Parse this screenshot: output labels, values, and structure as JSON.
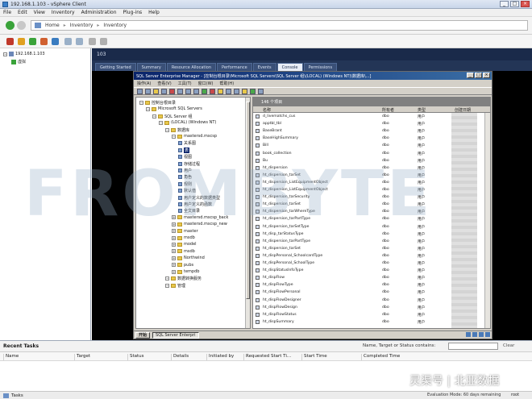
{
  "window": {
    "title": "192.168.1.103 - vSphere Client",
    "controls": [
      "_",
      "□",
      "×"
    ]
  },
  "menubar": [
    "File",
    "Edit",
    "View",
    "Inventory",
    "Administration",
    "Plug-ins",
    "Help"
  ],
  "navbar": {
    "path": [
      "Home",
      "Inventory",
      "Inventory"
    ]
  },
  "left_tree": [
    {
      "label": "192.168.1.103",
      "icon": "host-icon"
    },
    {
      "label": "虚拟",
      "icon": "vm-icon"
    }
  ],
  "right_pane": {
    "host_label": "103",
    "tabs": [
      "Getting Started",
      "Summary",
      "Resource Allocation",
      "Performance",
      "Events",
      "Console",
      "Permissions"
    ],
    "active_tab": "Console"
  },
  "sql_window": {
    "title": "SQL Server Enterprise Manager - [控制台根目录\\Microsoft SQL Servers\\SQL Server 组\\(LOCAL) (Windows NT)\\数据库\\...]",
    "menu": [
      "操作(A)",
      "查看(V)",
      "工具(T)",
      "窗口(W)",
      "帮助(H)"
    ],
    "tree": [
      {
        "label": "控制台根目录",
        "depth": 0,
        "kind": "folder"
      },
      {
        "label": "Microsoft SQL Servers",
        "depth": 1,
        "kind": "folder"
      },
      {
        "label": "SQL Server 组",
        "depth": 2,
        "kind": "folder"
      },
      {
        "label": "(LOCAL) (Windows NT)",
        "depth": 3,
        "kind": "server"
      },
      {
        "label": "数据库",
        "depth": 4,
        "kind": "folder"
      },
      {
        "label": "mastersd.mscsp",
        "depth": 5,
        "kind": "db"
      },
      {
        "label": "关系图",
        "depth": 6,
        "kind": "item"
      },
      {
        "label": "表",
        "depth": 6,
        "kind": "item",
        "selected": true
      },
      {
        "label": "视图",
        "depth": 6,
        "kind": "item"
      },
      {
        "label": "存储过程",
        "depth": 6,
        "kind": "item"
      },
      {
        "label": "用户",
        "depth": 6,
        "kind": "item"
      },
      {
        "label": "角色",
        "depth": 6,
        "kind": "item"
      },
      {
        "label": "规则",
        "depth": 6,
        "kind": "item"
      },
      {
        "label": "默认值",
        "depth": 6,
        "kind": "item"
      },
      {
        "label": "用户定义的数据类型",
        "depth": 6,
        "kind": "item"
      },
      {
        "label": "用户定义的函数",
        "depth": 6,
        "kind": "item"
      },
      {
        "label": "全文目录",
        "depth": 6,
        "kind": "item"
      },
      {
        "label": "mastersd.mscsp_back",
        "depth": 5,
        "kind": "db"
      },
      {
        "label": "mastersd.mscsp_new",
        "depth": 5,
        "kind": "db"
      },
      {
        "label": "master",
        "depth": 5,
        "kind": "db"
      },
      {
        "label": "msdb",
        "depth": 5,
        "kind": "db"
      },
      {
        "label": "model",
        "depth": 5,
        "kind": "db"
      },
      {
        "label": "msdb",
        "depth": 5,
        "kind": "db"
      },
      {
        "label": "Northwind",
        "depth": 5,
        "kind": "db"
      },
      {
        "label": "pubs",
        "depth": 5,
        "kind": "db"
      },
      {
        "label": "tempdb",
        "depth": 5,
        "kind": "db"
      },
      {
        "label": "数据转换服务",
        "depth": 4,
        "kind": "folder"
      },
      {
        "label": "管理",
        "depth": 4,
        "kind": "folder"
      }
    ],
    "grid_header": "146 个项目",
    "columns": [
      "名称",
      "所有者",
      "类型",
      "创建日期"
    ],
    "rows": [
      [
        "d_livematchs_cus",
        "dbo",
        "用户"
      ],
      [
        "apptbl_tbl",
        "dbo",
        "用户"
      ],
      [
        "BaseBrant",
        "dbo",
        "用户"
      ],
      [
        "BaseHighSummary",
        "dbo",
        "用户"
      ],
      [
        "Bill",
        "dbo",
        "用户"
      ],
      [
        "book_collection",
        "dbo",
        "用户"
      ],
      [
        "Bu",
        "dbo",
        "用户"
      ],
      [
        "ht_dispersion",
        "dbo",
        "用户"
      ],
      [
        "ht_dispersion_tarSet",
        "dbo",
        "用户"
      ],
      [
        "ht_dispersion_ListEquipmentObject",
        "dbo",
        "用户"
      ],
      [
        "ht_dispersion_ListEquipmentObject",
        "dbo",
        "用户"
      ],
      [
        "ht_dispersion_tarSecurity",
        "dbo",
        "用户"
      ],
      [
        "ht_dispersion_tarSet",
        "dbo",
        "用户"
      ],
      [
        "ht_dispersion_tarWhereType",
        "dbo",
        "用户"
      ],
      [
        "ht_dispersion_tarPartType",
        "dbo",
        "用户"
      ],
      [
        "ht_dispersion_tarSetType",
        "dbo",
        "用户"
      ],
      [
        "ht_disp_tarStatusType",
        "dbo",
        "用户"
      ],
      [
        "ht_dispersion_tarPartType",
        "dbo",
        "用户"
      ],
      [
        "ht_dispersion_tarSet",
        "dbo",
        "用户"
      ],
      [
        "ht_dispPersonal_SchoolcardType",
        "dbo",
        "用户"
      ],
      [
        "ht_dispPersonal_SchoolType",
        "dbo",
        "用户"
      ],
      [
        "ht_dispStatusInfoType",
        "dbo",
        "用户"
      ],
      [
        "ht_dispFlow",
        "dbo",
        "用户"
      ],
      [
        "ht_dispFlowType",
        "dbo",
        "用户"
      ],
      [
        "ht_dispFlowPersonal",
        "dbo",
        "用户"
      ],
      [
        "ht_dispFlowDesigner",
        "dbo",
        "用户"
      ],
      [
        "ht_dispFlowDesign",
        "dbo",
        "用户"
      ],
      [
        "ht_dispFlowStatus",
        "dbo",
        "用户"
      ],
      [
        "ht_dispSummary",
        "dbo",
        "用户"
      ]
    ],
    "taskbar": {
      "start": "开始",
      "task": "SQL Server Enterpri"
    }
  },
  "watermark": "FROMBYTE",
  "recent_tasks": {
    "title": "Recent Tasks",
    "filter_label": "Name, Target or Status contains:",
    "clear": "Clear",
    "columns": [
      "Name",
      "Target",
      "Status",
      "Details",
      "Initiated by",
      "Requested Start Ti...",
      "Start Time",
      "Completed Time"
    ]
  },
  "statusbar": {
    "tasks": "Tasks",
    "eval": "Evaluation Mode: 60 days remaining",
    "user": "root"
  },
  "logo": "灵渠号 | 北亚数据"
}
